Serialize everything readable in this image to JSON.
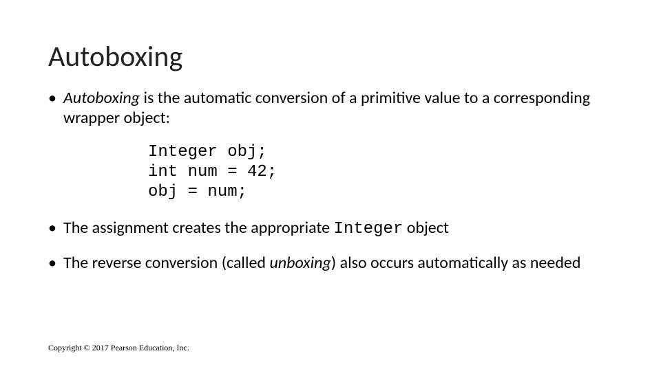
{
  "title": "Autoboxing",
  "bullet1": {
    "term": "Autoboxing",
    "rest": " is the automatic conversion of a primitive value to a corresponding wrapper object:"
  },
  "code": {
    "l1": "Integer obj;",
    "l2": "int num = 42;",
    "l3": "obj = num;"
  },
  "bullet2": {
    "pre": "The assignment creates the appropriate ",
    "code": "Integer",
    "post": " object"
  },
  "bullet3": {
    "pre": "The reverse conversion (called ",
    "term": "unboxing",
    "post": ") also occurs automatically as needed"
  },
  "copyright": "Copyright © 2017 Pearson Education, Inc."
}
